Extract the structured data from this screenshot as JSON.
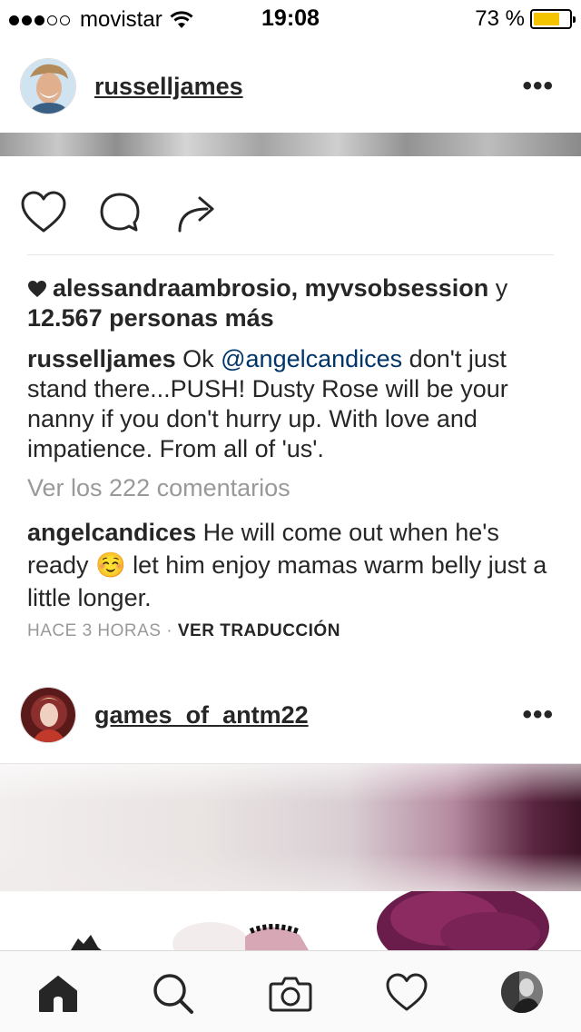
{
  "status_bar": {
    "carrier": "movistar",
    "time": "19:08",
    "battery_percent": "73 %",
    "battery_level": 0.73,
    "signal_bars": 3,
    "signal_total": 5
  },
  "post1": {
    "username": "russelljames",
    "more": "•••",
    "likes": {
      "users": "alessandraambrosio, myvsobsession",
      "conj": " y",
      "others": "12.567 personas más"
    },
    "caption": {
      "author": "russelljames",
      "text_before": " Ok ",
      "mention": "@angelcandices",
      "text_after": " don't just stand there...PUSH! Dusty Rose will be your nanny if you don't hurry up. With love and impatience. From all of 'us'."
    },
    "view_comments": "Ver los 222 comentarios",
    "comment": {
      "author": "angelcandices",
      "text_before": " He will come out when he's ready ",
      "emoji": "☺️",
      "text_after": " let him enjoy mamas warm belly just a little longer."
    },
    "time_ago": "HACE 3 HORAS",
    "separator": " · ",
    "translate": "VER TRADUCCIÓN"
  },
  "post2": {
    "username": "games_of_antm22",
    "more": "•••"
  },
  "tab_bar": {
    "items": [
      "home-icon",
      "search-icon",
      "camera-icon",
      "heart-icon",
      "profile-icon"
    ],
    "active": "home-icon"
  }
}
